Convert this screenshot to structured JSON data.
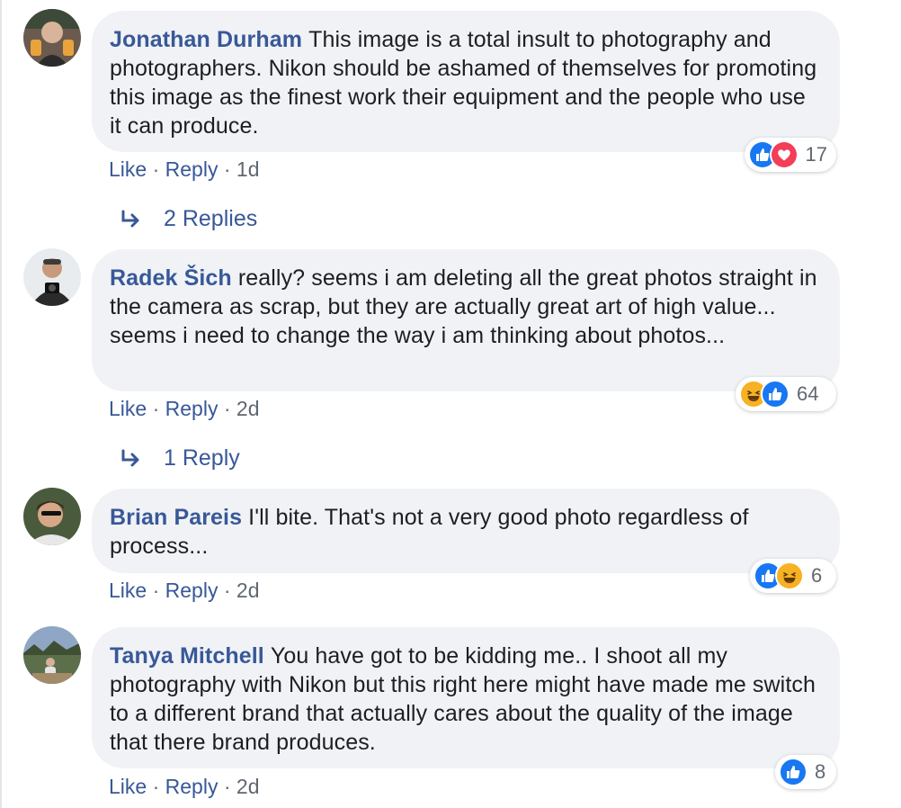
{
  "theme": {
    "link_color": "#385898",
    "bubble_bg": "#f0f2f5",
    "like_blue": "#1877f2",
    "love_red": "#f33e58",
    "haha_yellow": "#f7b125"
  },
  "comments": [
    {
      "author": "Jonathan Durham",
      "text": "This image is a total insult to photography and photographers. Nikon should be ashamed of themselves for promoting this image as the finest work their equipment and the people who use it can produce.",
      "reaction_icons": [
        "like-icon",
        "love-icon"
      ],
      "reaction_count": "17",
      "like_label": "Like",
      "reply_label": "Reply",
      "separator": "·",
      "time": "1d",
      "replies_label": "2 Replies"
    },
    {
      "author": "Radek Šich",
      "text": "really? seems i am deleting all the great photos straight in the camera as scrap, but they are actually great art of high value... seems i need to change the way i am thinking about photos...",
      "reaction_icons": [
        "haha-icon",
        "like-icon"
      ],
      "reaction_count": "64",
      "like_label": "Like",
      "reply_label": "Reply",
      "separator": "·",
      "time": "2d",
      "replies_label": "1 Reply"
    },
    {
      "author": "Brian Pareis",
      "text": "I'll bite. That's not a very good photo regardless of process...",
      "reaction_icons": [
        "like-icon",
        "haha-icon"
      ],
      "reaction_count": "6",
      "like_label": "Like",
      "reply_label": "Reply",
      "separator": "·",
      "time": "2d"
    },
    {
      "author": "Tanya Mitchell",
      "text": "You have got to be kidding me.. I shoot all my photography with Nikon but this right here might have made me switch to a different brand that actually cares about the quality of the image that there brand produces.",
      "reaction_icons": [
        "like-icon"
      ],
      "reaction_count": "8",
      "like_label": "Like",
      "reply_label": "Reply",
      "separator": "·",
      "time": "2d"
    }
  ]
}
